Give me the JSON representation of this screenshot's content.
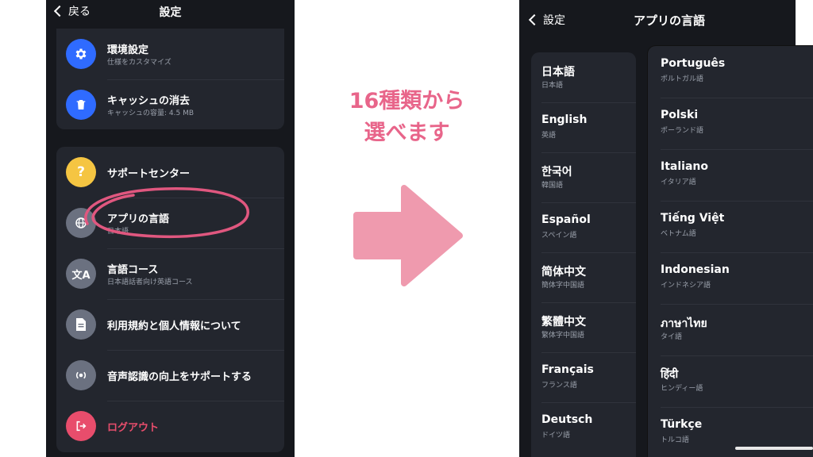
{
  "left_screen": {
    "back_label": "戻る",
    "title": "設定",
    "group1": [
      {
        "label": "環境設定",
        "sub": "仕様をカスタマイズ",
        "icon": "gear-icon",
        "color": "#2f6bff"
      },
      {
        "label": "キャッシュの消去",
        "sub": "キャッシュの容量: 4.5 MB",
        "icon": "trash-icon",
        "color": "#2f6bff"
      }
    ],
    "group2": [
      {
        "label": "サポートセンター",
        "sub": "",
        "icon": "question-icon",
        "color": "#f5c542"
      },
      {
        "label": "アプリの言語",
        "sub": "日本語",
        "icon": "globe-icon",
        "color": "#6b7180"
      },
      {
        "label": "言語コース",
        "sub": "日本語話者向け英語コース",
        "icon": "translate-icon",
        "color": "#6b7180"
      },
      {
        "label": "利用規約と個人情報について",
        "sub": "",
        "icon": "document-icon",
        "color": "#6b7180"
      },
      {
        "label": "音声認識の向上をサポートする",
        "sub": "",
        "icon": "voice-icon",
        "color": "#6b7180"
      },
      {
        "label": "ログアウト",
        "sub": "",
        "icon": "logout-icon",
        "color": "#e84d6c"
      }
    ],
    "highlight_color": "#e0577f"
  },
  "caption": {
    "line1": "16種類から",
    "line2": "選べます",
    "color": "#e8658a"
  },
  "arrow_color": "#ef9aae",
  "right_screen": {
    "back_label": "設定",
    "title": "アプリの言語",
    "languages_left": [
      {
        "name": "日本語",
        "sub": "日本語"
      },
      {
        "name": "English",
        "sub": "英語"
      },
      {
        "name": "한국어",
        "sub": "韓国語"
      },
      {
        "name": "Español",
        "sub": "スペイン語"
      },
      {
        "name": "简体中文",
        "sub": "簡体字中国語"
      },
      {
        "name": "繁體中文",
        "sub": "繁体字中国語"
      },
      {
        "name": "Français",
        "sub": "フランス語"
      },
      {
        "name": "Deutsch",
        "sub": "ドイツ語"
      }
    ],
    "languages_right": [
      {
        "name": "Português",
        "sub": "ポルトガル語"
      },
      {
        "name": "Polski",
        "sub": "ポーランド語"
      },
      {
        "name": "Italiano",
        "sub": "イタリア語"
      },
      {
        "name": "Tiếng Việt",
        "sub": "ベトナム語"
      },
      {
        "name": "Indonesian",
        "sub": "インドネシア語"
      },
      {
        "name": "ภาษาไทย",
        "sub": "タイ語"
      },
      {
        "name": "हिंदी",
        "sub": "ヒンディー語"
      },
      {
        "name": "Türkçe",
        "sub": "トルコ語"
      }
    ]
  }
}
